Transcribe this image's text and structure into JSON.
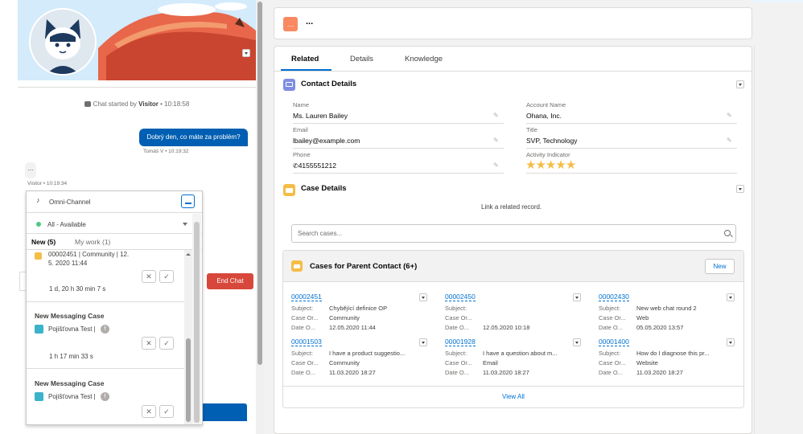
{
  "chat": {
    "started_prefix": "Chat started by",
    "started_by": "Visitor",
    "started_time": "• 10:18:58",
    "agent_message": "Dobrý den, co máte za problém?",
    "agent_meta": "Tomáš V • 10:19:32",
    "visitor_typing": "...",
    "visitor_meta": "Visitor • 10:19:34",
    "end_chat_label": "End Chat"
  },
  "omni": {
    "title": "Omni-Channel",
    "status": "All - Available",
    "status_color": "#4bca81",
    "tabs": [
      {
        "label": "New (5)"
      },
      {
        "label": "My work (1)"
      }
    ],
    "items": [
      {
        "line1": "00002451 | Community | 12.",
        "line2": "5. 2020 11:44",
        "wait": "1 d, 20 h 30 min 7 s"
      },
      {
        "title": "New Messaging Case",
        "source": "Pojišťovna Test |",
        "wait": "1 h 17 min 33 s"
      },
      {
        "title": "New Messaging Case",
        "source": "Pojišťovna Test |"
      }
    ]
  },
  "header": {
    "title": "..."
  },
  "tabs": [
    {
      "label": "Related"
    },
    {
      "label": "Details"
    },
    {
      "label": "Knowledge"
    }
  ],
  "contact_details": {
    "title": "Contact Details",
    "fields": {
      "name_label": "Name",
      "name": "Ms. Lauren Bailey",
      "account_label": "Account Name",
      "account": "Ohana, Inc.",
      "email_label": "Email",
      "email": "lbailey@example.com",
      "title_label": "Title",
      "title": "SVP, Technology",
      "phone_label": "Phone",
      "phone": "4155551212",
      "activity_label": "Activity Indicator",
      "activity_stars": 5
    }
  },
  "case_details": {
    "title": "Case Details",
    "link_text": "Link a related record.",
    "search_placeholder": "Search cases..."
  },
  "parent_cases": {
    "title": "Cases for Parent Contact (6+)",
    "new_label": "New",
    "view_all": "View All",
    "labels": {
      "subject": "Subject:",
      "origin": "Case Or...",
      "date": "Date O..."
    },
    "cases": [
      {
        "number": "00002451",
        "subject": "Chybějící definice OP",
        "origin": "Community",
        "date": "12.05.2020 11:44"
      },
      {
        "number": "00002450",
        "subject": "",
        "origin": "",
        "date": "12.05.2020 10:18"
      },
      {
        "number": "00002430",
        "subject": "New web chat round 2",
        "origin": "Web",
        "date": "05.05.2020 13:57"
      },
      {
        "number": "00001503",
        "subject": "I have a product suggestio...",
        "origin": "Community",
        "date": "11.03.2020 18:27"
      },
      {
        "number": "00001928",
        "subject": "I have a question about m...",
        "origin": "Email",
        "date": "11.03.2020 18:27"
      },
      {
        "number": "00001400",
        "subject": "How do I diagnose this pr...",
        "origin": "Website",
        "date": "11.03.2020 18:27"
      }
    ]
  },
  "colors": {
    "brand": "#0070d2",
    "contact_icon": "#7f8de1",
    "case_icon": "#f4bd46",
    "header_icon": "#f88962",
    "end_chat": "#d8473b"
  }
}
